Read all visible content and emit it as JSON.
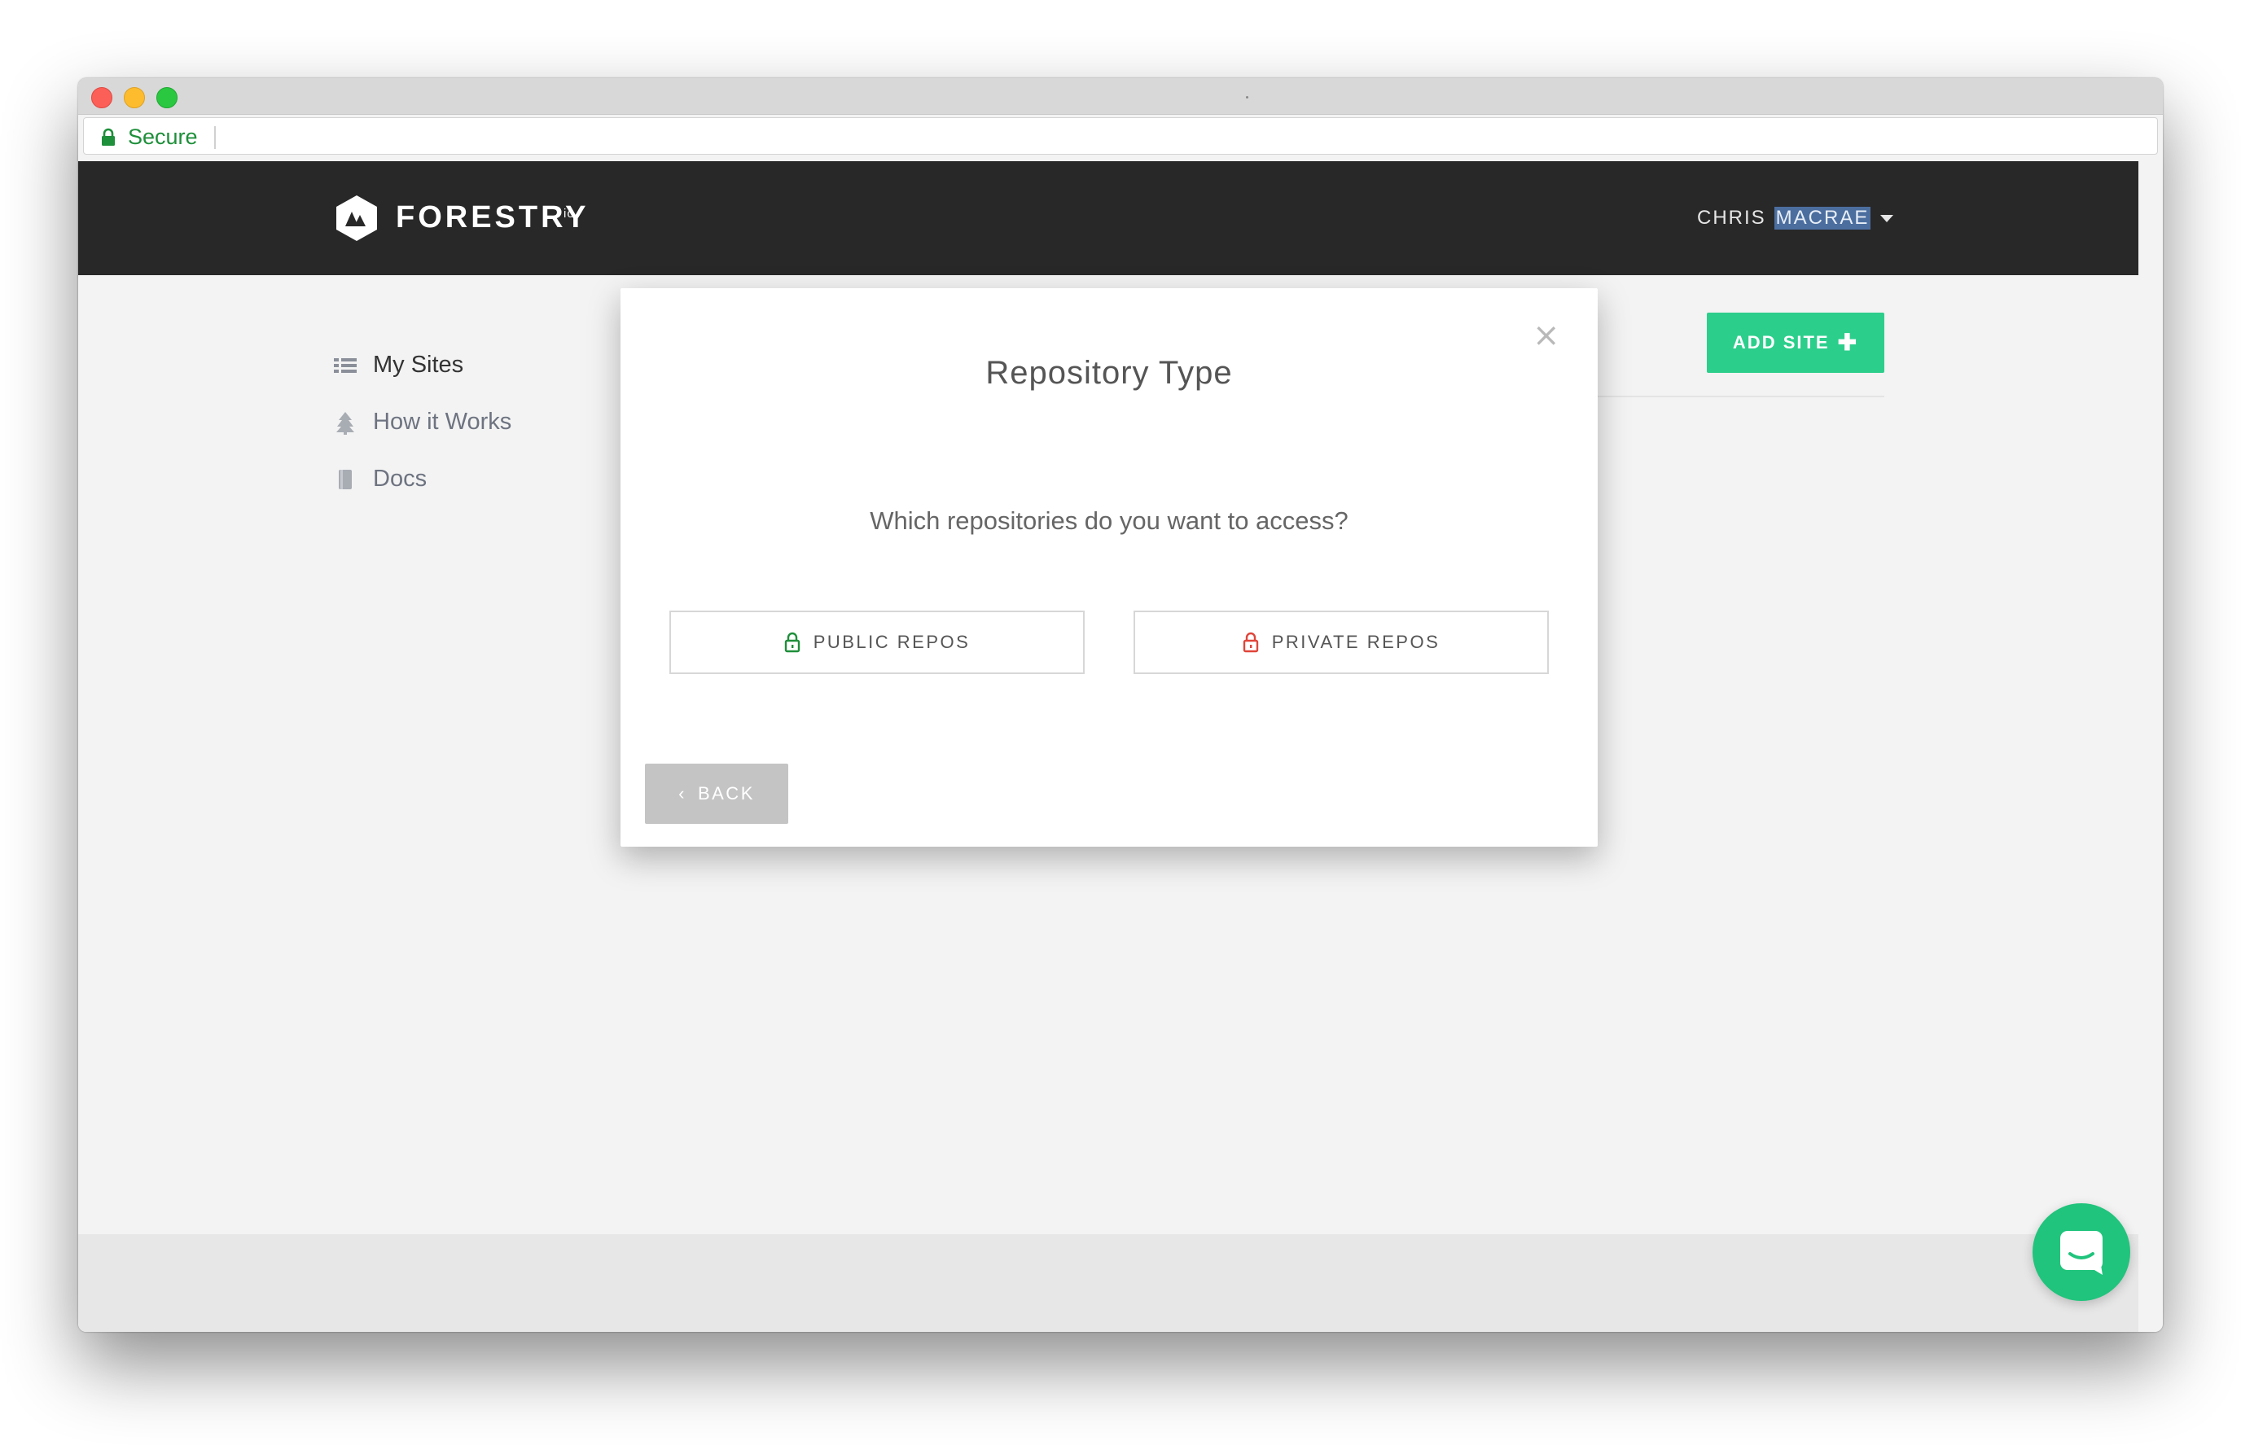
{
  "browser": {
    "secure_label": "Secure"
  },
  "navbar": {
    "logo_text": "FORESTRY",
    "logo_sup": "io",
    "user_first": "CHRIS",
    "user_last": "MACRAE"
  },
  "sidebar": {
    "items": [
      {
        "label": "My Sites",
        "icon": "list-icon"
      },
      {
        "label": "How it Works",
        "icon": "tree-icon"
      },
      {
        "label": "Docs",
        "icon": "book-icon"
      }
    ]
  },
  "content": {
    "add_site_label": "ADD SITE",
    "add_site_icon": "plus-icon"
  },
  "modal": {
    "title": "Repository Type",
    "question": "Which repositories do you want to access?",
    "public_label": "PUBLIC REPOS",
    "private_label": "PRIVATE REPOS",
    "back_label": "BACK",
    "close_symbol": "×"
  },
  "colors": {
    "navbar_bg": "#282828",
    "accent_green": "#2cce8c",
    "public_lock": "#1e8f3a",
    "private_lock": "#e0453a",
    "selection_highlight": "#4b6e9f"
  }
}
